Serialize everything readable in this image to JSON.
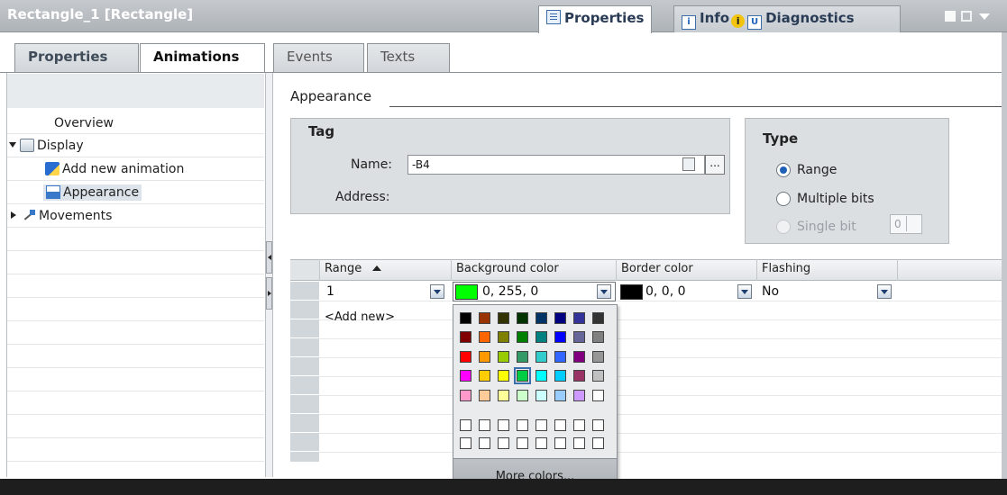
{
  "window": {
    "title": "Rectangle_1 [Rectangle]",
    "inspector_tabs": [
      {
        "label": "Properties",
        "icon": "properties-icon"
      },
      {
        "label": "Info",
        "icon": "info-icon"
      },
      {
        "label": "Diagnostics",
        "icon": "diagnostics-icon"
      }
    ],
    "info_badge": "i"
  },
  "tabs": [
    {
      "label": "Properties"
    },
    {
      "label": "Animations"
    },
    {
      "label": "Events"
    },
    {
      "label": "Texts"
    }
  ],
  "tree": {
    "items": [
      {
        "label": "Overview"
      },
      {
        "label": "Display",
        "icon": "display-icon"
      },
      {
        "label": "Add new animation",
        "icon": "add-animation-icon"
      },
      {
        "label": "Appearance",
        "icon": "appearance-icon"
      },
      {
        "label": "Movements",
        "icon": "movements-icon"
      }
    ]
  },
  "appearance": {
    "section_title": "Appearance",
    "tag": {
      "title": "Tag",
      "name_label": "Name:",
      "name_value": "-B4",
      "browse_label": "...",
      "address_label": "Address:"
    },
    "type": {
      "title": "Type",
      "options": [
        "Range",
        "Multiple bits",
        "Single bit"
      ],
      "selected": "Range",
      "single_bit_value": "0"
    }
  },
  "table": {
    "columns": [
      "Range",
      "Background color",
      "Border color",
      "Flashing"
    ],
    "rows": [
      {
        "range": "1",
        "background": "0, 255, 0",
        "background_hex": "#00ff00",
        "border": "0, 0, 0",
        "border_hex": "#000000",
        "flashing": "No"
      }
    ],
    "add_new": "<Add new>"
  },
  "color_picker": {
    "rows": [
      [
        "#000000",
        "#993300",
        "#333300",
        "#003300",
        "#003366",
        "#000080",
        "#333399",
        "#333333"
      ],
      [
        "#800000",
        "#ff6600",
        "#808000",
        "#008000",
        "#008080",
        "#0000ff",
        "#666699",
        "#808080"
      ],
      [
        "#ff0000",
        "#ff9900",
        "#99cc00",
        "#339966",
        "#33cccc",
        "#3366ff",
        "#800080",
        "#969696"
      ],
      [
        "#ff00ff",
        "#ffcc00",
        "#ffff00",
        "#00cc44",
        "#00ffff",
        "#00ccff",
        "#993366",
        "#c0c0c0"
      ],
      [
        "#ff99cc",
        "#ffcc99",
        "#ffff99",
        "#ccffcc",
        "#ccffff",
        "#99ccff",
        "#cc99ff",
        "#ffffff"
      ]
    ],
    "custom_rows": [
      [
        "#ffffff",
        "#ffffff",
        "#ffffff",
        "#ffffff",
        "#ffffff",
        "#ffffff",
        "#ffffff",
        "#ffffff",
        "#ffffff"
      ],
      [
        "#ffffff",
        "#ffffff",
        "#ffffff",
        "#ffffff",
        "#ffffff",
        "#ffffff",
        "#ffffff",
        "#ffffff",
        "#ffffff"
      ]
    ],
    "more_label": "More colors..."
  }
}
